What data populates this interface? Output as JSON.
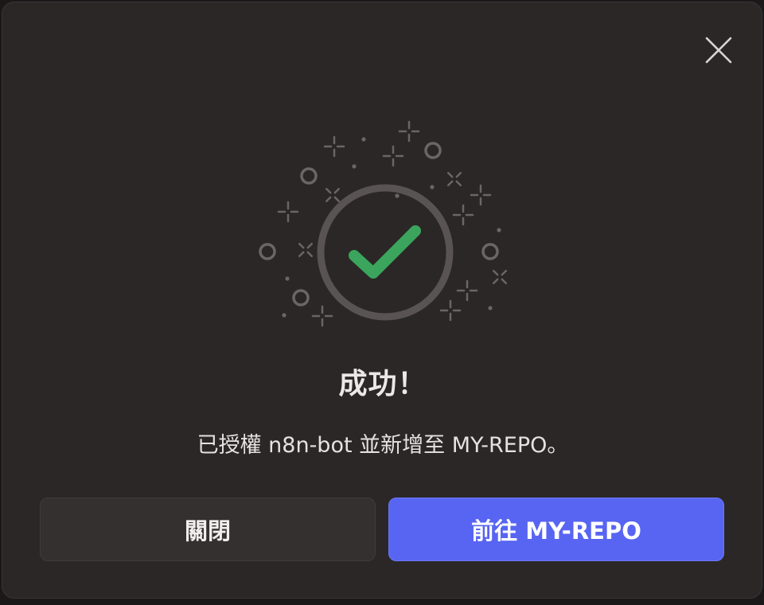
{
  "dialog": {
    "title": "成功！",
    "message": "已授權 n8n-bot 並新增至 MY-REPO。",
    "close_label": "關閉",
    "primary_label": "前往 MY-REPO",
    "close_icon": "close-icon",
    "success_icon": "checkmark-icon"
  },
  "colors": {
    "background": "#2b2727",
    "accent": "#5865f2",
    "success": "#3ba55d",
    "ring": "#595353"
  }
}
